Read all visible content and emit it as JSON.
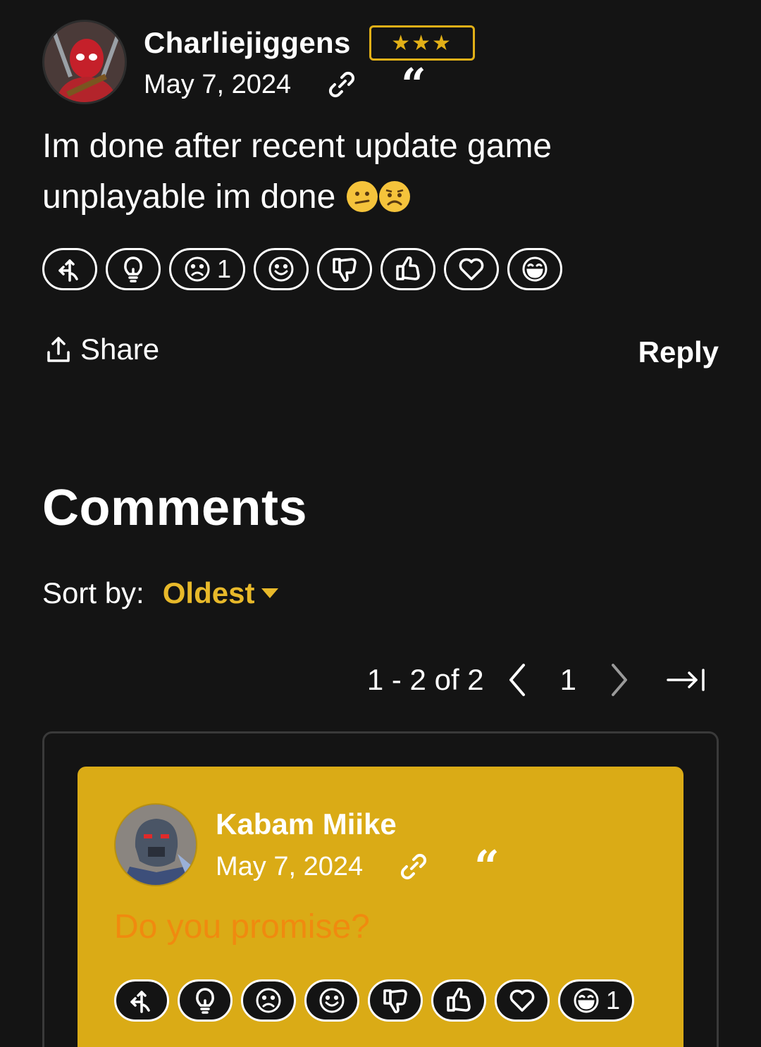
{
  "post": {
    "username": "Charliejiggens",
    "rank": "★★★",
    "date": "May 7, 2024",
    "body": "Im done after recent update game unplayable im done",
    "emojis": [
      "confused-face",
      "worried-face"
    ],
    "reactions": [
      {
        "name": "off-topic",
        "count": ""
      },
      {
        "name": "insightful",
        "count": ""
      },
      {
        "name": "sad",
        "count": "1"
      },
      {
        "name": "smile",
        "count": ""
      },
      {
        "name": "disagree",
        "count": ""
      },
      {
        "name": "agree",
        "count": ""
      },
      {
        "name": "love",
        "count": ""
      },
      {
        "name": "lol",
        "count": ""
      }
    ],
    "share_label": "Share",
    "reply_label": "Reply"
  },
  "comments": {
    "title": "Comments",
    "sort_label": "Sort by:",
    "sort_value": "Oldest",
    "pager": {
      "range": "1 - 2 of 2",
      "page": "1"
    },
    "items": [
      {
        "username": "Kabam Miike",
        "date": "May 7, 2024",
        "body": "Do you promise?",
        "reactions": [
          {
            "name": "off-topic",
            "count": ""
          },
          {
            "name": "insightful",
            "count": ""
          },
          {
            "name": "sad",
            "count": ""
          },
          {
            "name": "smile",
            "count": ""
          },
          {
            "name": "disagree",
            "count": ""
          },
          {
            "name": "agree",
            "count": ""
          },
          {
            "name": "love",
            "count": ""
          },
          {
            "name": "lol",
            "count": "1"
          }
        ]
      }
    ]
  },
  "colors": {
    "background": "#141414",
    "accent": "#e8b92a",
    "card": "#daab16",
    "comment_text": "#f08a0f"
  }
}
